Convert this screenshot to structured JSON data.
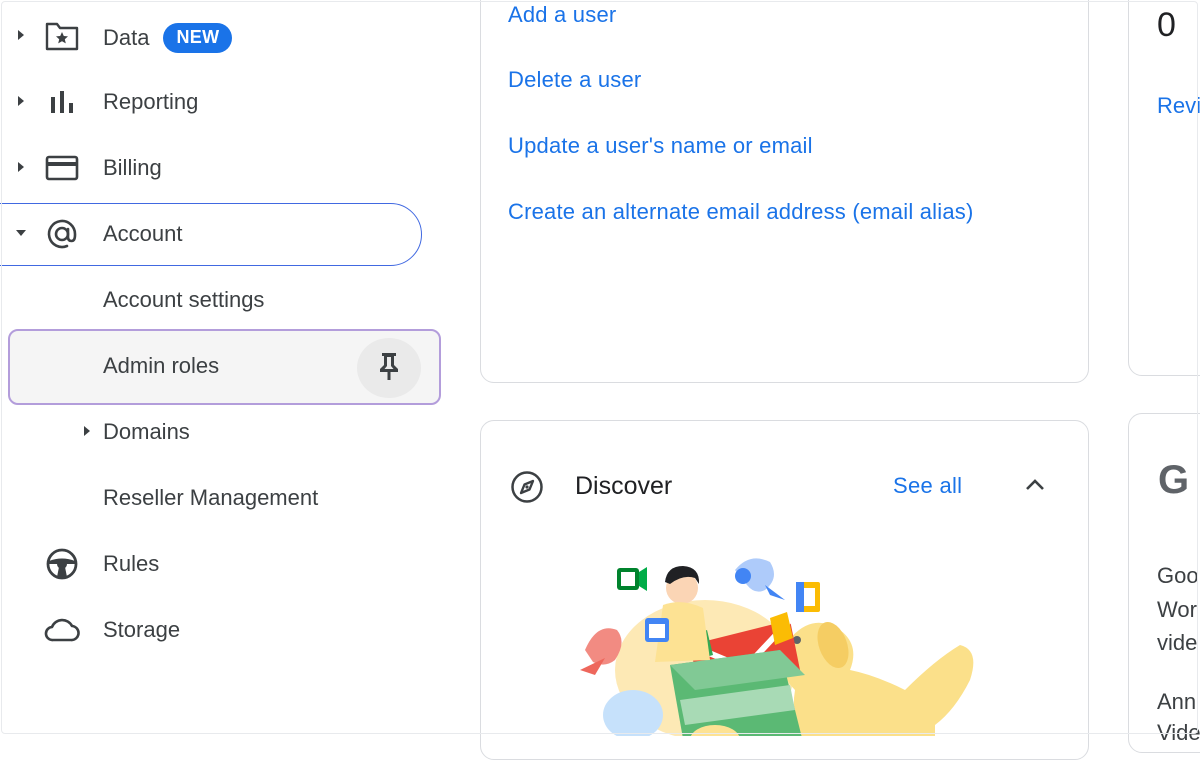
{
  "sidebar": {
    "items": [
      {
        "label": "Data",
        "badge": "NEW",
        "icon": "folder-star-icon",
        "expanded": false
      },
      {
        "label": "Reporting",
        "icon": "bar-chart-icon",
        "expanded": false
      },
      {
        "label": "Billing",
        "icon": "credit-card-icon",
        "expanded": false
      },
      {
        "label": "Account",
        "icon": "at-sign-icon",
        "expanded": true
      }
    ],
    "account_children": [
      {
        "label": "Account settings"
      },
      {
        "label": "Admin roles",
        "pin_icon": "pin-icon"
      },
      {
        "label": "Domains",
        "expandable": true
      },
      {
        "label": "Reseller Management"
      }
    ],
    "bottom_items": [
      {
        "label": "Rules",
        "icon": "steering-wheel-icon"
      },
      {
        "label": "Storage",
        "icon": "cloud-icon"
      }
    ]
  },
  "users_card": {
    "links": [
      "Add a user",
      "Delete a user",
      "Update a user's name or email",
      "Create an alternate email address (email alias)"
    ]
  },
  "right_top_card": {
    "count": "0",
    "link": "Revi"
  },
  "discover_card": {
    "icon": "compass-icon",
    "title": "Discover",
    "see_all": "See all",
    "collapse_icon": "chevron-up-icon"
  },
  "right_bottom_card": {
    "logo": "G",
    "lines": [
      "Goo",
      "Wor",
      "vide",
      "Ann",
      "Vide"
    ]
  },
  "colors": {
    "accent": "#1a73e8",
    "focus_ring": "#b39ddb",
    "pill_border": "#4169e1"
  }
}
